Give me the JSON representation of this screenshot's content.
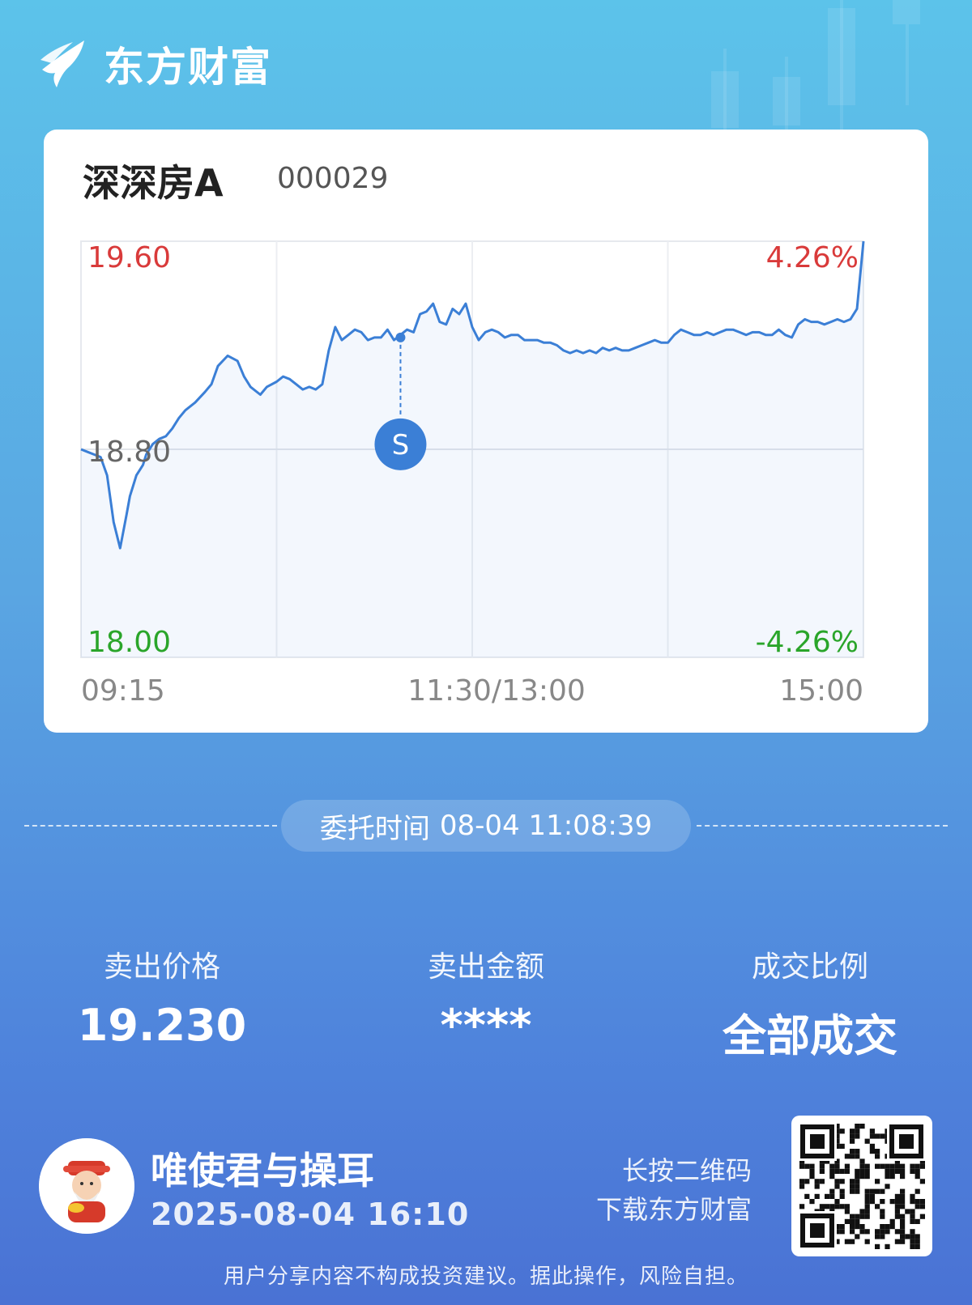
{
  "brand": {
    "name": "东方财富",
    "logo_icon": "eastmoney-logo-icon"
  },
  "stock": {
    "name": "深深房A",
    "code": "000029"
  },
  "chart_data": {
    "type": "line",
    "x_ticks": [
      "09:15",
      "11:30/13:00",
      "15:00"
    ],
    "y_left_ticks": [
      "19.60",
      "18.80",
      "18.00"
    ],
    "y_right_ticks": [
      "4.26%",
      "-4.26%"
    ],
    "ylim": [
      18.0,
      19.6
    ],
    "base_price": 18.8,
    "colors": {
      "up": "#d93a3a",
      "down": "#2aa52a",
      "base": "#666666",
      "line": "#3b7fd6",
      "marker": "#3b7fd6"
    },
    "marker": {
      "label": "S",
      "time": "11:08",
      "price": 19.23
    },
    "series": [
      {
        "x": [
          0,
          2,
          4,
          6,
          8,
          10,
          12,
          14,
          15,
          16,
          17,
          18,
          19,
          20,
          22,
          24,
          26,
          28,
          30,
          32,
          35,
          38,
          40,
          42,
          45,
          48,
          50,
          52,
          55,
          57,
          60,
          62,
          64,
          66,
          68,
          70,
          72,
          74,
          76,
          78,
          80,
          82,
          84,
          86,
          88,
          90,
          92,
          94,
          96,
          98,
          100,
          102,
          104,
          106,
          108,
          110,
          112,
          114,
          116,
          118,
          120,
          122,
          124,
          126,
          128,
          130,
          132,
          134,
          136,
          138,
          140,
          142,
          144,
          146,
          148,
          150,
          152,
          154,
          156,
          158,
          160,
          162,
          164,
          166,
          168,
          170,
          172,
          174,
          176,
          178,
          180,
          182,
          184,
          186,
          188,
          190,
          192,
          194,
          196,
          198,
          200,
          202,
          204,
          206,
          208,
          210,
          212,
          214,
          216,
          218,
          220,
          222,
          224,
          226,
          228,
          230,
          232,
          234,
          236,
          238,
          240
        ],
        "y": [
          18.8,
          18.79,
          18.78,
          18.77,
          18.7,
          18.52,
          18.42,
          18.55,
          18.62,
          18.66,
          18.7,
          18.72,
          18.74,
          18.78,
          18.82,
          18.84,
          18.85,
          18.88,
          18.92,
          18.95,
          18.98,
          19.02,
          19.05,
          19.12,
          19.16,
          19.14,
          19.08,
          19.04,
          19.01,
          19.04,
          19.06,
          19.08,
          19.07,
          19.05,
          19.03,
          19.04,
          19.03,
          19.05,
          19.18,
          19.27,
          19.22,
          19.24,
          19.26,
          19.25,
          19.22,
          19.23,
          19.23,
          19.26,
          19.22,
          19.24,
          19.26,
          19.25,
          19.32,
          19.33,
          19.36,
          19.29,
          19.28,
          19.34,
          19.32,
          19.36,
          19.27,
          19.22,
          19.25,
          19.26,
          19.25,
          19.23,
          19.24,
          19.24,
          19.22,
          19.22,
          19.22,
          19.21,
          19.21,
          19.2,
          19.18,
          19.17,
          19.18,
          19.17,
          19.18,
          19.17,
          19.19,
          19.18,
          19.19,
          19.18,
          19.18,
          19.19,
          19.2,
          19.21,
          19.22,
          19.21,
          19.21,
          19.24,
          19.26,
          19.25,
          19.24,
          19.24,
          19.25,
          19.24,
          19.25,
          19.26,
          19.26,
          19.25,
          19.24,
          19.25,
          19.25,
          19.24,
          19.24,
          19.26,
          19.24,
          19.23,
          19.28,
          19.3,
          19.29,
          19.29,
          19.28,
          19.29,
          19.3,
          19.29,
          19.3,
          19.34,
          19.6
        ]
      }
    ]
  },
  "order": {
    "label": "委托时间",
    "time": "08-04 11:08:39"
  },
  "stats": [
    {
      "label": "卖出价格",
      "value": "19.230"
    },
    {
      "label": "卖出金额",
      "value": "****"
    },
    {
      "label": "成交比例",
      "value": "全部成交"
    }
  ],
  "user": {
    "name": "唯使君与操耳",
    "share_time": "2025-08-04 16:10",
    "avatar_icon": "god-of-wealth-avatar"
  },
  "qr": {
    "hint_line1": "长按二维码",
    "hint_line2": "下载东方财富",
    "icon": "qr-code-icon"
  },
  "disclaimer": "用户分享内容不构成投资建议。据此操作，风险自担。"
}
